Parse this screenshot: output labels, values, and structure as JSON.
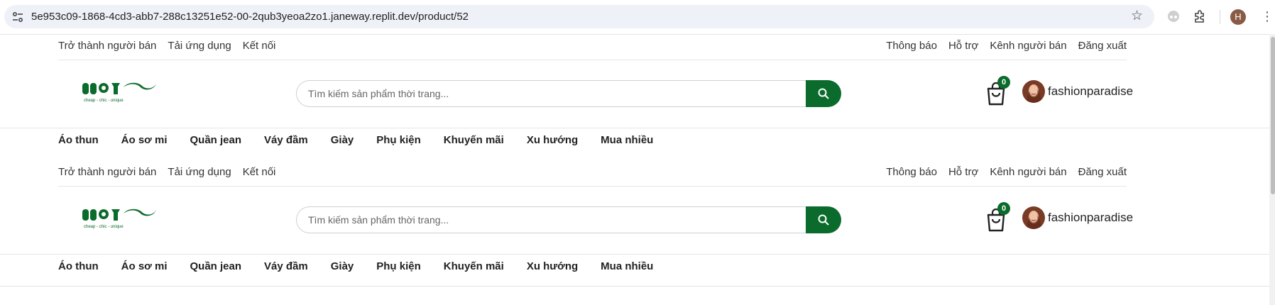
{
  "browser": {
    "url": "5e953c09-1868-4cd3-abb7-288c13251e52-00-2qub3yeoa2zo1.janeway.replit.dev/product/52",
    "profile_initial": "H",
    "icons": [
      "site-info-icon",
      "bookmark-star-icon",
      "incognito-icon",
      "extensions-icon",
      "profile-avatar",
      "more-menu-icon"
    ]
  },
  "header": {
    "top_links_left": [
      "Trở thành người bán",
      "Tải ứng dụng",
      "Kết nối"
    ],
    "top_links_right": [
      "Thông báo",
      "Hỗ trợ",
      "Kênh người bán",
      "Đăng xuất"
    ],
    "logo": {
      "tagline": "cheap - chic - unique",
      "color": "#0b6b2c"
    },
    "search_placeholder": "Tìm kiếm sản phẩm thời trang...",
    "cart_count": "0",
    "username": "fashionparadise",
    "nav_items": [
      "Áo thun",
      "Áo sơ mi",
      "Quần jean",
      "Váy đầm",
      "Giày",
      "Phụ kiện",
      "Khuyến mãi",
      "Xu hướng",
      "Mua nhiều"
    ]
  },
  "colors": {
    "brand": "#0b6b2c",
    "border": "#e6e6e6"
  }
}
